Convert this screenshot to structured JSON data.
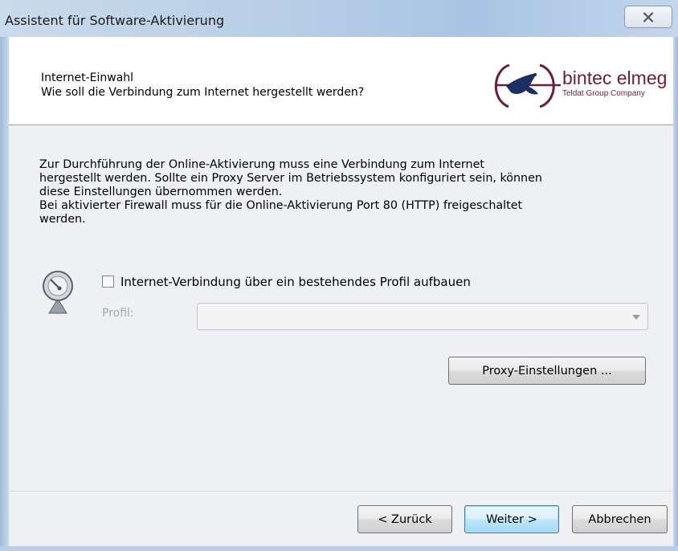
{
  "window": {
    "title": "Assistent für Software-Aktivierung"
  },
  "header": {
    "title": "Internet-Einwahl",
    "subtitle": "Wie soll die Verbindung zum Internet hergestellt werden?",
    "logo": {
      "brand": "bintec elmeg",
      "tagline": "Teldat Group Company",
      "brand_color": "#6b1e3c",
      "accent_color": "#1c2f63"
    }
  },
  "content": {
    "description_lines": [
      "Zur Durchführung der Online-Aktivierung muss eine Verbindung zum Internet",
      "hergestellt werden. Sollte ein Proxy Server im Betriebssystem konfiguriert sein, können",
      "diese Einstellungen übernommen werden.",
      "Bei aktivierter Firewall muss für die Online-Aktivierung Port 80 (HTTP) freigeschaltet",
      "werden."
    ],
    "connection_icon": "satellite-dish-icon",
    "profile_checkbox": {
      "label": "Internet-Verbindung über ein bestehendes Profil aufbauen",
      "checked": false
    },
    "profile": {
      "label": "Profil:",
      "selected_value": "",
      "enabled": false
    },
    "proxy_button": "Proxy-Einstellungen ..."
  },
  "footer": {
    "back_label": "< Zurück",
    "next_label": "Weiter >",
    "cancel_label": "Abbrechen"
  }
}
